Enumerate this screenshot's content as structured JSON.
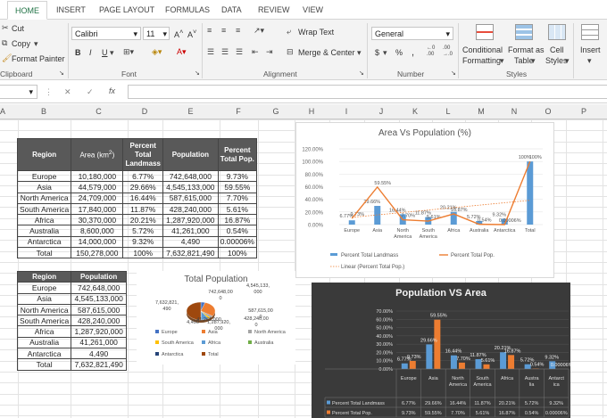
{
  "ribbon": {
    "tabs": [
      "HOME",
      "INSERT",
      "PAGE LAYOUT",
      "FORMULAS",
      "DATA",
      "REVIEW",
      "VIEW"
    ],
    "clipboard": {
      "cut": "Cut",
      "copy": "Copy",
      "format_painter": "Format Painter",
      "label": "Clipboard"
    },
    "font": {
      "name": "Calibri",
      "size": "11",
      "label": "Font",
      "bold": "B",
      "italic": "I",
      "underline": "U"
    },
    "alignment": {
      "wrap_text": "Wrap Text",
      "merge_center": "Merge & Center",
      "label": "Alignment"
    },
    "number": {
      "format": "General",
      "currency": "$",
      "percent": "%",
      "comma": ",",
      "label": "Number"
    },
    "styles": {
      "conditional": "Conditional",
      "conditional2": "Formatting",
      "format_as": "Format as",
      "format_as2": "Table",
      "cell": "Cell",
      "cell2": "Styles",
      "label": "Styles"
    },
    "cells": {
      "insert": "Insert"
    }
  },
  "formula_bar": {
    "fx": "fx",
    "cancel": "✕",
    "confirm": "✓"
  },
  "columns": [
    "A",
    "B",
    "C",
    "D",
    "E",
    "F",
    "G",
    "H",
    "I",
    "J",
    "K",
    "L",
    "M",
    "N",
    "O",
    "P"
  ],
  "table1": {
    "headers": [
      "Region",
      "Area (km²)",
      "Percent Total Landmass",
      "Population",
      "Percent Total Pop."
    ],
    "rows": [
      [
        "Europe",
        "10,180,000",
        "6.77%",
        "742,648,000",
        "9.73%"
      ],
      [
        "Asia",
        "44,579,000",
        "29.66%",
        "4,545,133,000",
        "59.55%"
      ],
      [
        "North America",
        "24,709,000",
        "16.44%",
        "587,615,000",
        "7.70%"
      ],
      [
        "South America",
        "17,840,000",
        "11.87%",
        "428,240,000",
        "5.61%"
      ],
      [
        "Africa",
        "30,370,000",
        "20.21%",
        "1,287,920,000",
        "16.87%"
      ],
      [
        "Australia",
        "8,600,000",
        "5.72%",
        "41,261,000",
        "0.54%"
      ],
      [
        "Antarctica",
        "14,000,000",
        "9.32%",
        "4,490",
        "0.00006%"
      ],
      [
        "Total",
        "150,278,000",
        "100%",
        "7,632,821,490",
        "100%"
      ]
    ]
  },
  "table2": {
    "headers": [
      "Region",
      "Population"
    ],
    "rows": [
      [
        "Europe",
        "742,648,000"
      ],
      [
        "Asia",
        "4,545,133,000"
      ],
      [
        "North America",
        "587,615,000"
      ],
      [
        "South America",
        "428,240,000"
      ],
      [
        "Africa",
        "1,287,920,000"
      ],
      [
        "Australia",
        "41,261,000"
      ],
      [
        "Antarctica",
        "4,490"
      ],
      [
        "Total",
        "7,632,821,490"
      ]
    ]
  },
  "chart_data": [
    {
      "type": "bar",
      "title": "Area Vs Population (%)",
      "categories": [
        "Europe",
        "Asia",
        "North America",
        "South America",
        "Africa",
        "Australia",
        "Antarctica",
        "Total"
      ],
      "series": [
        {
          "name": "Percent Total Landmass",
          "type": "bar",
          "values": [
            6.77,
            29.66,
            16.44,
            11.87,
            20.21,
            5.72,
            9.32,
            100
          ],
          "color": "#5b9bd5"
        },
        {
          "name": "Percent Total Pop.",
          "type": "line",
          "values": [
            9.73,
            59.55,
            7.7,
            5.61,
            16.87,
            0.54,
            6e-05,
            100
          ],
          "color": "#ed7d31"
        },
        {
          "name": "Linear (Percent Total Pop.)",
          "type": "trendline",
          "color": "#ed7d31"
        }
      ],
      "data_labels_landmass": [
        "6.77%",
        "29.66%",
        "16.44%",
        "11.87%",
        "20.21%",
        "5.72%",
        "9.32%",
        "100%"
      ],
      "data_labels_pop": [
        "9.73%",
        "59.55%",
        "7.70%",
        "5.61%",
        "16.87%",
        "0.54%",
        "0.00006%",
        "100%"
      ],
      "yticks": [
        "120.00%",
        "100.00%",
        "80.00%",
        "60.00%",
        "40.00%",
        "20.00%",
        "0.00%"
      ],
      "ylim": [
        0,
        120
      ]
    },
    {
      "type": "pie",
      "title": "Total Population",
      "categories": [
        "Europe",
        "Asia",
        "North America",
        "South America",
        "Africa",
        "Australia",
        "Antarctica",
        "Total"
      ],
      "values": [
        742648000,
        4545133000,
        587615000,
        428240000,
        1287920000,
        41261000,
        4490,
        7632821490
      ],
      "labels": [
        "742,648,00\n0",
        "4,545,133,\n000",
        "587,615,00\n0",
        "428,240,00\n0",
        "1,287,920,\n000",
        "41,261,000",
        "4,490",
        "7,632,821,\n490"
      ],
      "colors": [
        "#4472c4",
        "#ed7d31",
        "#a5a5a5",
        "#ffc000",
        "#5b9bd5",
        "#70ad47",
        "#264478",
        "#9e480e"
      ]
    },
    {
      "type": "bar",
      "title": "Population VS Area",
      "categories": [
        "Europe",
        "Asia",
        "North America",
        "South America",
        "Africa",
        "Australia",
        "Antarctica"
      ],
      "category_labels": [
        "Europe",
        "Asia",
        "North\nAmerica",
        "South\nAmerica",
        "Africa",
        "Austra\nlia",
        "Antarct\nica"
      ],
      "series": [
        {
          "name": "Percent Total Landmass",
          "values": [
            6.77,
            29.66,
            16.44,
            11.87,
            20.21,
            5.72,
            9.32
          ],
          "labels": [
            "6.77%",
            "29.66%",
            "16.44%",
            "11.87%",
            "20.21%",
            "5.72%",
            "9.32%"
          ],
          "color": "#5b9bd5"
        },
        {
          "name": "Percent Total Pop.",
          "values": [
            9.73,
            59.55,
            7.7,
            5.61,
            16.87,
            0.54,
            6e-05
          ],
          "labels": [
            "9.73%",
            "59.55%",
            "7.70%",
            "5.61%",
            "16.87%",
            "0.54%",
            "0.00006%"
          ],
          "color": "#ed7d31"
        }
      ],
      "yticks": [
        "70.00%",
        "60.00%",
        "50.00%",
        "40.00%",
        "30.00%",
        "20.00%",
        "10.00%",
        "0.00%"
      ],
      "ylim": [
        0,
        70
      ]
    }
  ]
}
